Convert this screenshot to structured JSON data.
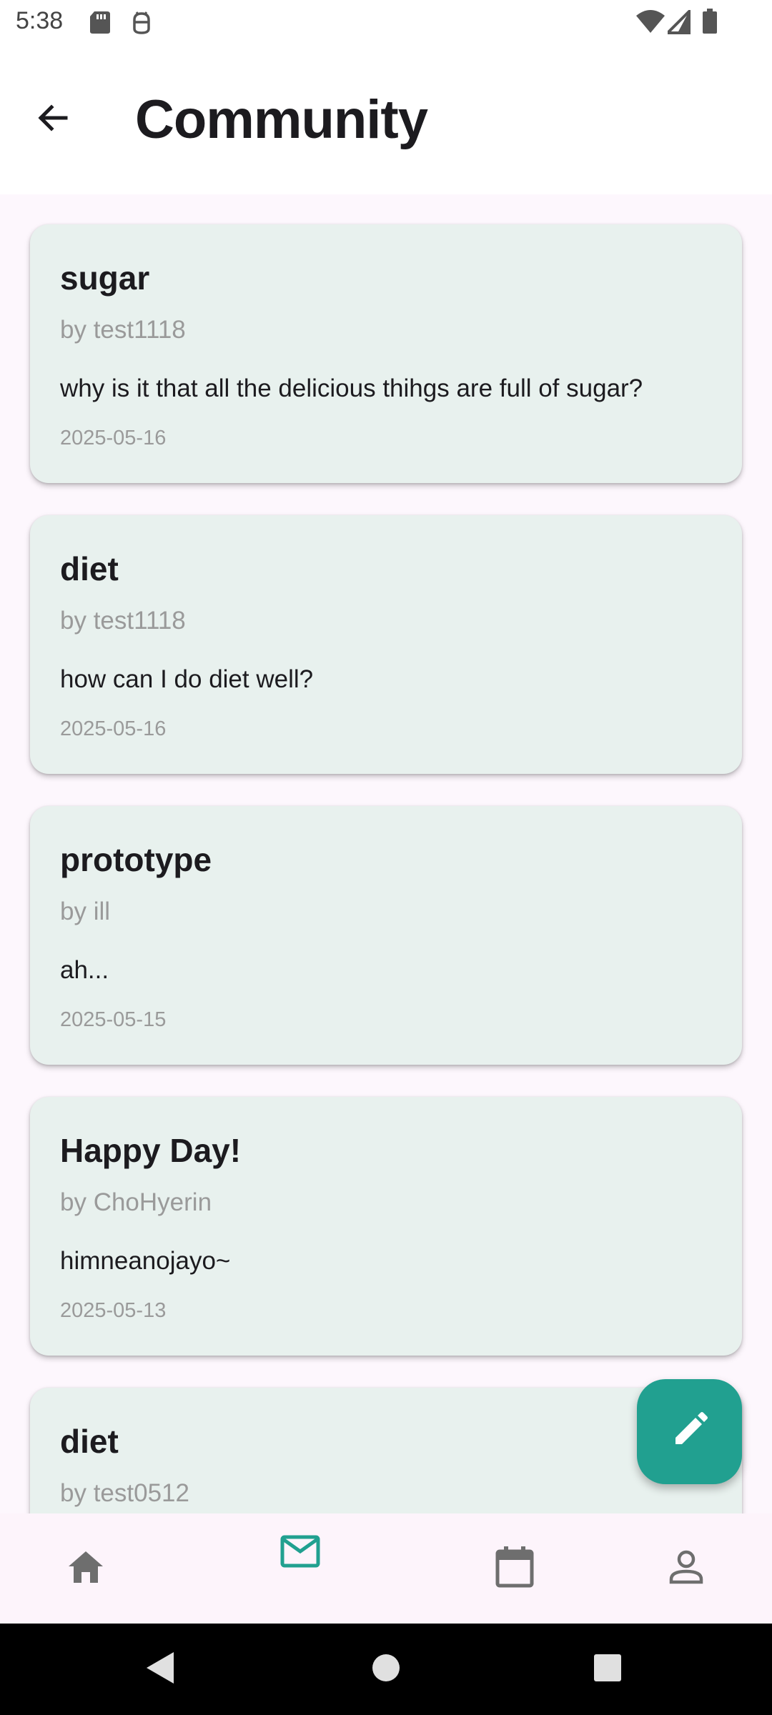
{
  "status_bar": {
    "time": "5:38",
    "icons": [
      "sd-card-icon",
      "android-debug-icon",
      "wifi-icon",
      "cell-signal-icon",
      "battery-icon"
    ]
  },
  "header": {
    "title": "Community",
    "back_icon": "arrow-back-icon"
  },
  "posts": [
    {
      "title": "sugar",
      "author": "by test1118",
      "body": "why is it that all the delicious thihgs are full of sugar?",
      "date": "2025-05-16"
    },
    {
      "title": "diet",
      "author": "by test1118",
      "body": "how can I do diet well?",
      "date": "2025-05-16"
    },
    {
      "title": "prototype",
      "author": "by ill",
      "body": "ah...",
      "date": "2025-05-15"
    },
    {
      "title": "Happy Day!",
      "author": "by ChoHyerin",
      "body": "himneanojayo~",
      "date": "2025-05-13"
    },
    {
      "title": "diet",
      "author": "by test0512",
      "body": "",
      "date": ""
    }
  ],
  "fab": {
    "icon": "pencil-icon"
  },
  "bottom_nav": {
    "items": [
      {
        "icon": "home-icon",
        "selected": false
      },
      {
        "icon": "mail-icon",
        "selected": true
      },
      {
        "icon": "calendar-icon",
        "selected": false
      },
      {
        "icon": "person-icon",
        "selected": false
      }
    ]
  },
  "system_nav": {
    "icons": [
      "back-triangle-icon",
      "home-circle-icon",
      "recents-square-icon"
    ]
  },
  "colors": {
    "accent": "#21a090",
    "card_background": "#e8f1ee",
    "page_background": "#fdf7fd",
    "muted_text": "#9a9a9a",
    "nav_inactive": "#6e6e6e"
  }
}
